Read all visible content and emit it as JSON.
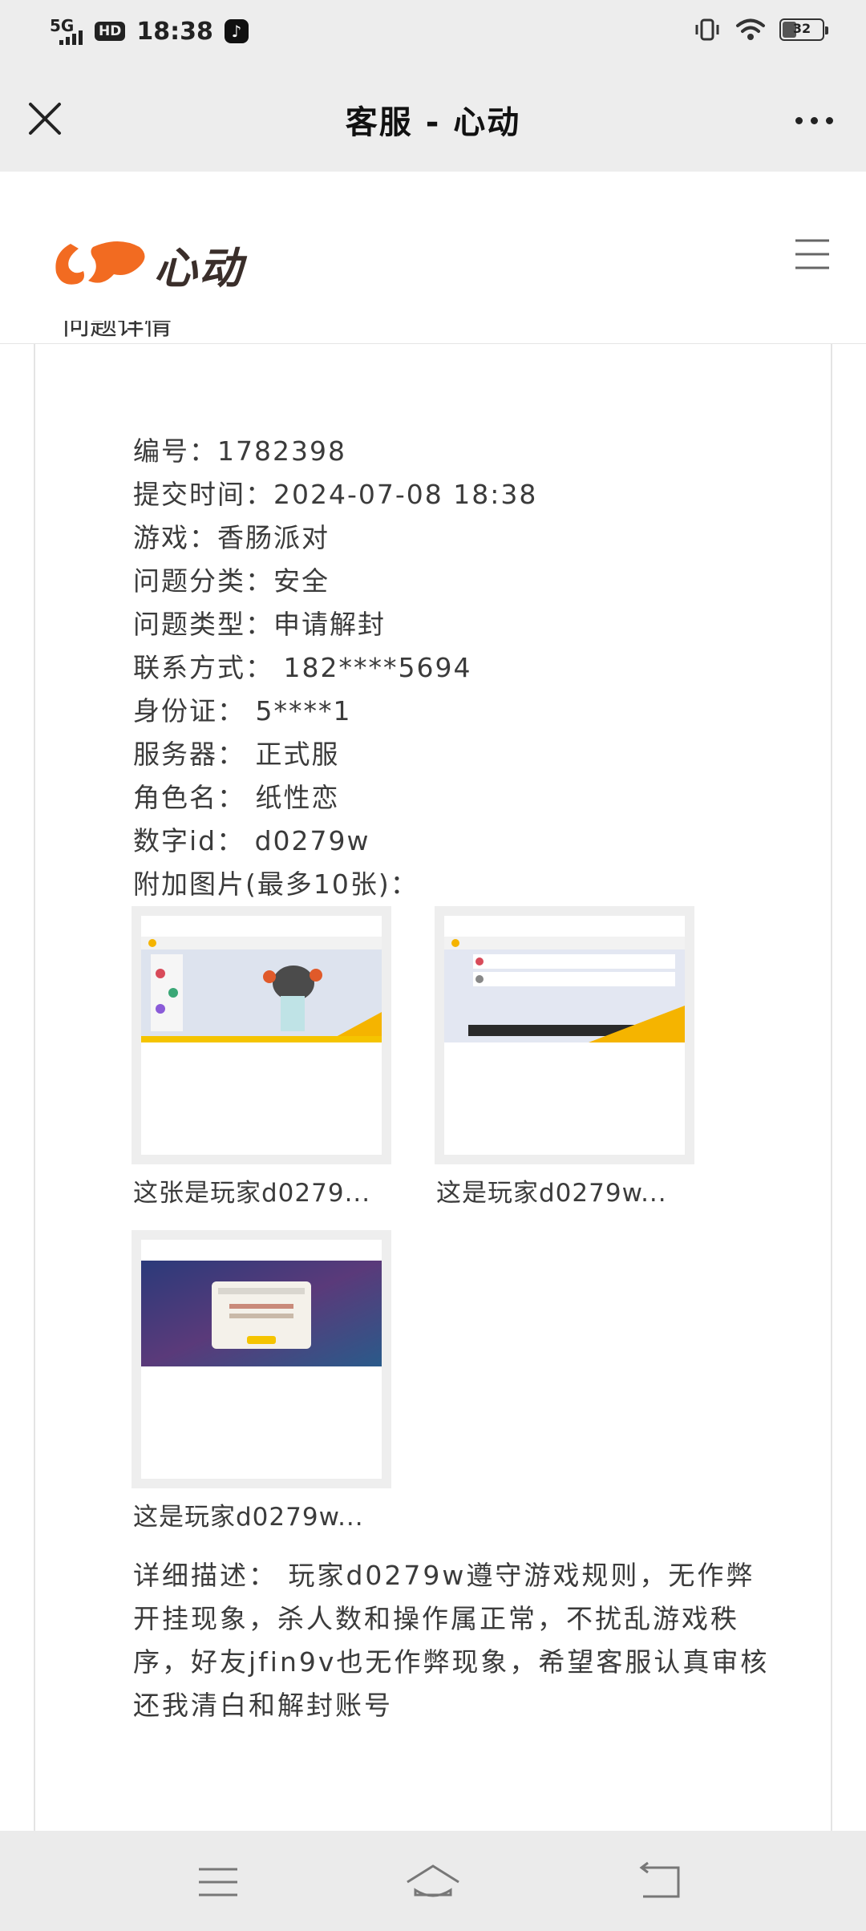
{
  "status_bar": {
    "network": "5G",
    "hd_badge": "HD",
    "time": "18:38",
    "app_icon": "tiktok-icon",
    "vibrate_icon": "vibrate-icon",
    "wifi_icon": "wifi-icon",
    "battery_level": "32"
  },
  "title_bar": {
    "title": "客服 - 心动",
    "close_icon": "close-icon",
    "more_icon": "more-icon"
  },
  "site_header": {
    "logo_text": "心动",
    "menu_icon": "hamburger-menu-icon"
  },
  "ticket": {
    "clipped_heading": "问题详情",
    "rows": [
      "编号：1782398",
      "提交时间：2024-07-08 18:38",
      "游戏：香肠派对",
      "问题分类：安全",
      "问题类型：申请解封",
      "联系方式： 182****5694",
      "身份证： 5****1",
      "服务器： 正式服",
      "角色名： 纸性恋",
      "数字id： d0279w",
      "附加图片(最多10张)："
    ],
    "images": [
      {
        "caption": "这张是玩家d0279..."
      },
      {
        "caption": "这是玩家d0279w..."
      },
      {
        "caption": "这是玩家d0279w..."
      }
    ],
    "description": "详细描述： 玩家d0279w遵守游戏规则，无作弊开挂现象，杀人数和操作属正常，不扰乱游戏秩序，好友jfin9v也无作弊现象，希望客服认真审核还我清白和解封账号"
  },
  "bottom_nav": {
    "menu_icon": "menu-icon",
    "home_icon": "home-icon",
    "back_icon": "back-icon"
  },
  "colors": {
    "bar_background": "#ededed",
    "logo_orange": "#f26b21",
    "text": "#3b3b3b"
  }
}
